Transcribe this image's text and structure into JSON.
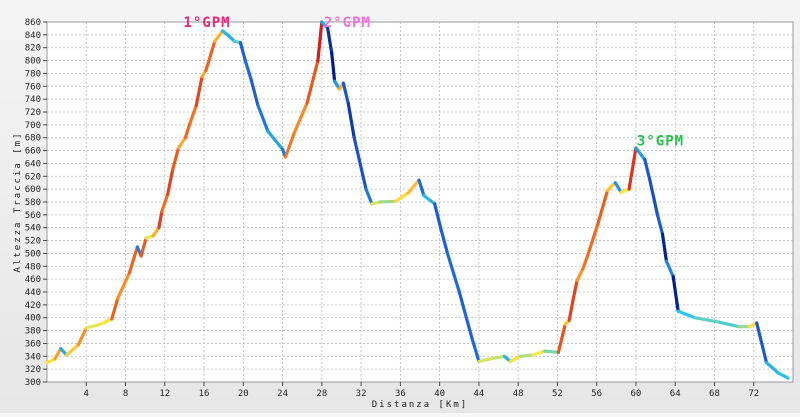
{
  "chart_data": {
    "type": "line",
    "xlabel": "Distanza [Km]",
    "ylabel": "Altezza Traccia [m]",
    "xlim": [
      0,
      76
    ],
    "ylim": [
      300,
      860
    ],
    "x_ticks": [
      4,
      8,
      12,
      16,
      20,
      24,
      28,
      32,
      36,
      40,
      44,
      48,
      52,
      56,
      60,
      64,
      68,
      72
    ],
    "y_ticks": [
      300,
      320,
      340,
      360,
      380,
      400,
      420,
      440,
      460,
      480,
      500,
      520,
      540,
      560,
      580,
      600,
      620,
      640,
      660,
      680,
      700,
      720,
      740,
      760,
      780,
      800,
      820,
      840,
      860
    ],
    "grid": true,
    "line_coloring": "gradient by slope: yellow near flat, orange/red climbing, cyan to dark blue descending",
    "annotations": [
      {
        "text": "1°GPM",
        "x": 16.3,
        "y": 852,
        "color": "#e8267a"
      },
      {
        "text": "2°GPM",
        "x": 30.6,
        "y": 852,
        "color": "#f070d8"
      },
      {
        "text": "3°GPM",
        "x": 62.5,
        "y": 668,
        "color": "#22c24a"
      }
    ],
    "points": [
      [
        0,
        330
      ],
      [
        0.8,
        336
      ],
      [
        1.4,
        352
      ],
      [
        2,
        342
      ],
      [
        3.2,
        358
      ],
      [
        4,
        384
      ],
      [
        5.5,
        390
      ],
      [
        6.6,
        398
      ],
      [
        7.2,
        430
      ],
      [
        7.9,
        453
      ],
      [
        8.4,
        470
      ],
      [
        9.2,
        510
      ],
      [
        9.6,
        496
      ],
      [
        10.1,
        524
      ],
      [
        10.8,
        527
      ],
      [
        11.4,
        540
      ],
      [
        11.7,
        565
      ],
      [
        12.3,
        592
      ],
      [
        12.8,
        630
      ],
      [
        13.4,
        664
      ],
      [
        14.1,
        680
      ],
      [
        14.6,
        704
      ],
      [
        15.2,
        730
      ],
      [
        15.8,
        775
      ],
      [
        16.2,
        785
      ],
      [
        16.7,
        810
      ],
      [
        17.1,
        830
      ],
      [
        17.9,
        846
      ],
      [
        18.4,
        840
      ],
      [
        19.1,
        830
      ],
      [
        19.7,
        828
      ],
      [
        20.2,
        800
      ],
      [
        20.8,
        770
      ],
      [
        21.5,
        730
      ],
      [
        22.5,
        690
      ],
      [
        24,
        662
      ],
      [
        24.3,
        650
      ],
      [
        25.2,
        688
      ],
      [
        26.5,
        734
      ],
      [
        27.6,
        800
      ],
      [
        28,
        860
      ],
      [
        28.6,
        850
      ],
      [
        29,
        812
      ],
      [
        29.3,
        768
      ],
      [
        29.8,
        756
      ],
      [
        30.2,
        765
      ],
      [
        30.7,
        733
      ],
      [
        31.3,
        680
      ],
      [
        32.5,
        600
      ],
      [
        33.1,
        577
      ],
      [
        33.9,
        580
      ],
      [
        35.5,
        581
      ],
      [
        36.8,
        594
      ],
      [
        37.9,
        614
      ],
      [
        38.4,
        590
      ],
      [
        39.5,
        577
      ],
      [
        40.1,
        540
      ],
      [
        40.8,
        500
      ],
      [
        42,
        440
      ],
      [
        43.3,
        368
      ],
      [
        44,
        332
      ],
      [
        45.5,
        337
      ],
      [
        46.6,
        340
      ],
      [
        47.2,
        332
      ],
      [
        48.2,
        340
      ],
      [
        49.5,
        342
      ],
      [
        50.7,
        348
      ],
      [
        52.1,
        346
      ],
      [
        52.8,
        390
      ],
      [
        53.2,
        396
      ],
      [
        53.6,
        428
      ],
      [
        54,
        458
      ],
      [
        54.6,
        476
      ],
      [
        55.1,
        498
      ],
      [
        56.1,
        545
      ],
      [
        57.1,
        598
      ],
      [
        57.9,
        610
      ],
      [
        58.5,
        595
      ],
      [
        59.3,
        600
      ],
      [
        60,
        664
      ],
      [
        60.9,
        646
      ],
      [
        61.4,
        615
      ],
      [
        62.2,
        560
      ],
      [
        62.7,
        530
      ],
      [
        63.1,
        488
      ],
      [
        63.8,
        464
      ],
      [
        64.3,
        410
      ],
      [
        66,
        400
      ],
      [
        68.5,
        393
      ],
      [
        70.5,
        386
      ],
      [
        71.6,
        386
      ],
      [
        72.3,
        392
      ],
      [
        73.3,
        330
      ],
      [
        74.5,
        314
      ],
      [
        75.5,
        306
      ]
    ]
  }
}
